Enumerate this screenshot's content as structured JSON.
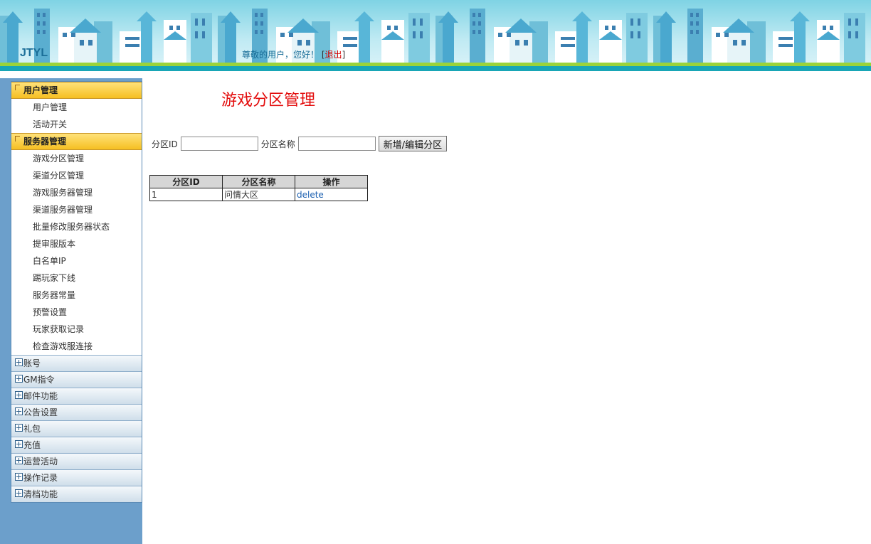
{
  "header": {
    "logo": "JTYL",
    "greeting": "尊敬的用户，您好！",
    "bracket_open": "[",
    "logout": "退出",
    "bracket_close": "]"
  },
  "sidebar": {
    "groups": [
      {
        "title": "用户管理",
        "items": [
          "用户管理",
          "活动开关"
        ]
      },
      {
        "title": "服务器管理",
        "items": [
          "游戏分区管理",
          "渠道分区管理",
          "游戏服务器管理",
          "渠道服务器管理",
          "批量修改服务器状态",
          "提审服版本",
          "白名单IP",
          "踢玩家下线",
          "服务器常量",
          "预警设置",
          "玩家获取记录",
          "检查游戏服连接"
        ]
      }
    ],
    "collapsed": [
      "账号",
      "GM指令",
      "邮件功能",
      "公告设置",
      "礼包",
      "充值",
      "运营活动",
      "操作记录",
      "清档功能"
    ]
  },
  "main": {
    "title": "游戏分区管理",
    "form": {
      "id_label": "分区ID",
      "id_value": "",
      "name_label": "分区名称",
      "name_value": "",
      "submit": "新增/编辑分区"
    },
    "table": {
      "headers": [
        "分区ID",
        "分区名称",
        "操作"
      ],
      "rows": [
        {
          "id": "1",
          "name": "问情大区",
          "action": "delete"
        }
      ]
    }
  },
  "colors": {
    "title_red": "#e30d0d",
    "sidebar_bg": "#6c9fcb",
    "menu_head": "#f6bf22",
    "link_blue": "#1a5fb0"
  }
}
